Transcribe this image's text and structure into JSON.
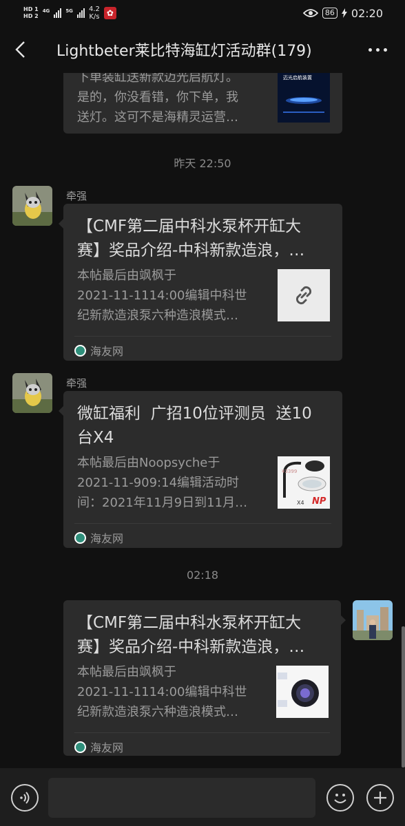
{
  "status_bar": {
    "hd1": "HD 1",
    "hd2": "HD 2",
    "net1": "4G",
    "net2": "5G",
    "speed_value": "4.2",
    "speed_unit": "K/s",
    "battery": "86",
    "time": "02:20"
  },
  "header": {
    "title": "Lightbeter莱比特海缸灯活动群(179)"
  },
  "messages": {
    "m0": {
      "desc": "下单装缸送新款迈光启航灯。是的，你没看错，你下单，我送灯。这可不是海精灵运营…",
      "desc_line1": "下单装缸送新款迈光启航灯。",
      "desc_line2": "是的，你没看错，你下单，我",
      "desc_line3": "送灯。这可不是海精灵运营…",
      "thumb_text": "迈光启航装置"
    },
    "ts1": "昨天 22:50",
    "m1": {
      "sender": "牵强",
      "title": "【CMF第二届中科水泵杯开缸大赛】奖品介绍-中科新款造浪，...",
      "title_line1": "【CMF第二届中科水泵杯开缸大",
      "title_line2": "赛】奖品介绍-中科新款造浪，…",
      "desc_line1": "本帖最后由飒枫于",
      "desc_line2": "2021-11-1114:00编辑中科世",
      "desc_line3": "纪新款造浪泵六种造浪模式…",
      "source": "海友网"
    },
    "m2": {
      "sender": "牵强",
      "title_line1": "微缸福利  广招10位评测员  送10",
      "title_line2": "台X4",
      "desc_line1": "本帖最后由Noopsyche于",
      "desc_line2": "2021-11-909:14编辑活动时",
      "desc_line3": "间：2021年11月9日到11月…",
      "thumb_price": "¥3399",
      "thumb_model": "X4",
      "thumb_brand": "NP",
      "source": "海友网"
    },
    "ts2": "02:18",
    "m3": {
      "title_line1": "【CMF第二届中科水泵杯开缸大",
      "title_line2": "赛】奖品介绍-中科新款造浪，…",
      "desc_line1": "本帖最后由飒枫于",
      "desc_line2": "2021-11-1114:00编辑中科世",
      "desc_line3": "纪新款造浪泵六种造浪模式…",
      "source": "海友网"
    }
  },
  "icons": {
    "back": "chevron-left-icon",
    "more": "more-dots-icon",
    "link": "link-icon",
    "voice": "voice-icon",
    "emoji": "emoji-icon",
    "plus": "plus-icon"
  },
  "colors": {
    "background": "#111111",
    "bubble": "#2c2c2c",
    "link_thumb": "#ebebeb"
  }
}
